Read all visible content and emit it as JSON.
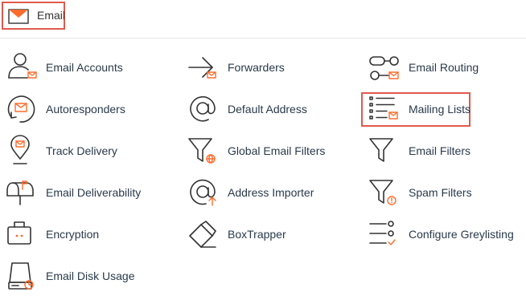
{
  "header": {
    "title": "Email"
  },
  "items": [
    {
      "label": "Email Accounts",
      "icon": "user-mail-icon"
    },
    {
      "label": "Forwarders",
      "icon": "forward-arrow-icon"
    },
    {
      "label": "Email Routing",
      "icon": "routing-icon"
    },
    {
      "label": "Autoresponders",
      "icon": "autoresponder-icon"
    },
    {
      "label": "Default Address",
      "icon": "at-sign-icon"
    },
    {
      "label": "Mailing Lists",
      "icon": "mailing-list-icon"
    },
    {
      "label": "Track Delivery",
      "icon": "location-pin-icon"
    },
    {
      "label": "Global Email Filters",
      "icon": "global-filter-icon"
    },
    {
      "label": "Email Filters",
      "icon": "filter-icon"
    },
    {
      "label": "Email Deliverability",
      "icon": "mailbox-icon"
    },
    {
      "label": "Address Importer",
      "icon": "address-importer-icon"
    },
    {
      "label": "Spam Filters",
      "icon": "spam-filter-icon"
    },
    {
      "label": "Encryption",
      "icon": "briefcase-lock-icon"
    },
    {
      "label": "BoxTrapper",
      "icon": "box-trap-icon"
    },
    {
      "label": "Configure Greylisting",
      "icon": "greylisting-checklist-icon"
    },
    {
      "label": "Email Disk Usage",
      "icon": "disk-usage-icon"
    }
  ],
  "colors": {
    "accent": "#ff6c2c",
    "highlight_border": "#e05a4c",
    "link_text": "#293a4a"
  }
}
